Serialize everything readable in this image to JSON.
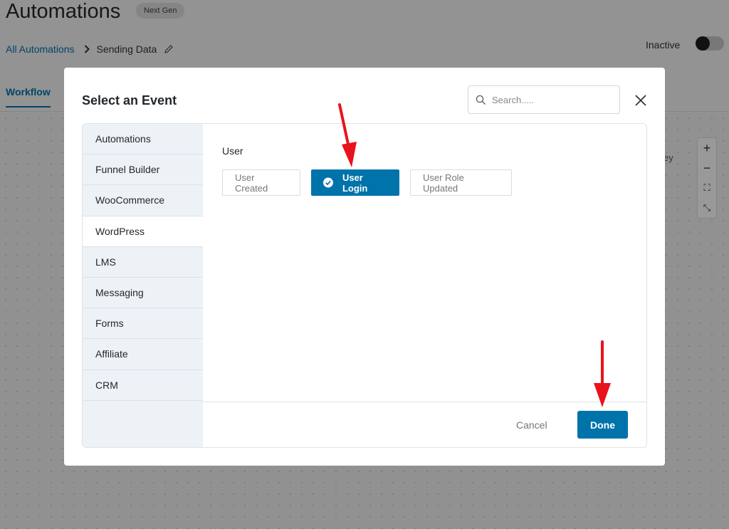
{
  "header": {
    "title": "Automations",
    "badge": "Next Gen",
    "breadcrumb": {
      "link": "All Automations",
      "current": "Sending Data"
    },
    "status_label": "Inactive"
  },
  "tabs": {
    "workflow": "Workflow"
  },
  "canvas": {
    "zoom_in": "+",
    "zoom_out": "−",
    "fit_symbol": "⛶",
    "expand_symbol": "⤡",
    "fragment_text": "ey"
  },
  "modal": {
    "title": "Select an Event",
    "search_placeholder": "Search.....",
    "sidebar": [
      {
        "label": "Automations"
      },
      {
        "label": "Funnel Builder"
      },
      {
        "label": "WooCommerce"
      },
      {
        "label": "WordPress",
        "active": true
      },
      {
        "label": "LMS"
      },
      {
        "label": "Messaging"
      },
      {
        "label": "Forms"
      },
      {
        "label": "Affiliate"
      },
      {
        "label": "CRM"
      }
    ],
    "group_label": "User",
    "events": [
      {
        "label": "User Created",
        "selected": false
      },
      {
        "label": "User Login",
        "selected": true
      },
      {
        "label": "User Role Updated",
        "selected": false
      }
    ],
    "cancel_label": "Cancel",
    "done_label": "Done"
  },
  "colors": {
    "accent": "#0073aa",
    "annotation_arrow": "#e8131b"
  }
}
